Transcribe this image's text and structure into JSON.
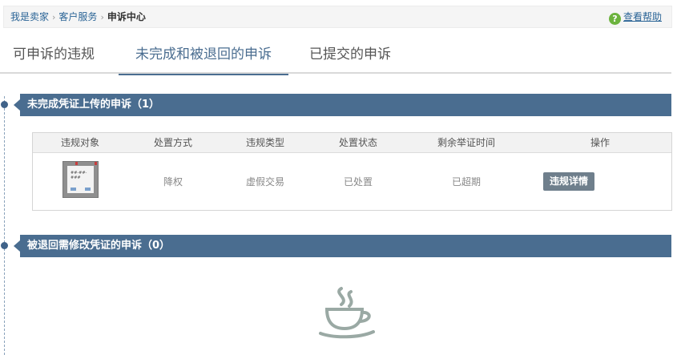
{
  "breadcrumb": {
    "items": [
      "我是卖家",
      "客户服务"
    ],
    "separator": "›",
    "current": "申诉中心"
  },
  "help": {
    "icon": "question-circle-icon",
    "label": "查看帮助"
  },
  "tabs": [
    {
      "label": "可申诉的违规",
      "active": false
    },
    {
      "label": "未完成和被退回的申诉",
      "active": true
    },
    {
      "label": "已提交的申诉",
      "active": false
    }
  ],
  "section_incomplete": {
    "title": "未完成凭证上传的申诉（1）",
    "columns": [
      "违规对象",
      "处置方式",
      "违规类型",
      "处置状态",
      "剩余举证时间",
      "操作"
    ],
    "rows": [
      {
        "thumbnail_text": "##-##-###",
        "action": "降权",
        "type": "虚假交易",
        "status": "已处置",
        "remaining": "已超期",
        "button": "违规详情"
      }
    ]
  },
  "section_returned": {
    "title": "被退回需修改凭证的申诉（0）",
    "empty_icon": "coffee-cup-icon"
  },
  "colors": {
    "accent": "#4a6d90",
    "button": "#6f7f8c",
    "help_icon": "#6cb33e",
    "link": "#2a6496"
  }
}
